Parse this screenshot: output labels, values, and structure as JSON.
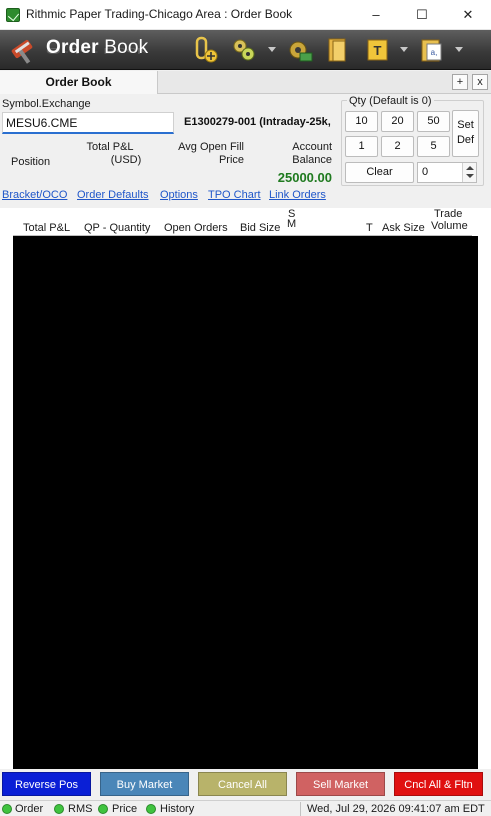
{
  "window": {
    "title": "Rithmic Paper Trading-Chicago Area : Order Book",
    "minimize_glyph": "–",
    "maximize_glyph": "☐",
    "close_glyph": "✕"
  },
  "toolbar": {
    "logo_bold": "Order",
    "logo_light": " Book",
    "icons": [
      "add-order-icon",
      "connect-icon",
      "settings-icon",
      "folder-icon",
      "text-icon",
      "clipboard-icon"
    ]
  },
  "panel": {
    "tab_label": "Order Book",
    "add_glyph": "+",
    "close_glyph": "x"
  },
  "info": {
    "symbol_label": "Symbol.Exchange",
    "symbol_value": "MESU6.CME",
    "account": "E1300279-001 (Intraday-25k,",
    "position_label": "Position",
    "total_pnl_label": "Total P&L",
    "total_pnl_unit": "(USD)",
    "avg_fill_label1": "Avg Open Fill",
    "avg_fill_label2": "Price",
    "account_balance_label1": "Account",
    "account_balance_label2": "Balance",
    "account_balance": "25000.00"
  },
  "qty": {
    "title": "Qty (Default is 0)",
    "buttons": [
      "10",
      "20",
      "50",
      "1",
      "2",
      "5"
    ],
    "set_def_line1": "Set",
    "set_def_line2": "Def",
    "clear_label": "Clear",
    "value": "0"
  },
  "links": [
    "Bracket/OCO",
    "Order Defaults",
    "Options",
    "TPO Chart",
    "Link Orders"
  ],
  "columns": {
    "total_pnl": "Total P&L",
    "qp_quantity": "QP - Quantity",
    "open_orders": "Open Orders",
    "bid_size": "Bid Size",
    "s": "S",
    "m": "M",
    "t": "T",
    "ask_size": "Ask Size",
    "trade": "Trade",
    "volume": "Volume"
  },
  "actions": {
    "reverse_pos": "Reverse Pos",
    "buy_market": "Buy Market",
    "cancel_all": "Cancel All",
    "sell_market": "Sell Market",
    "cncl_all_fltn": "Cncl All & Fltn",
    "colors": {
      "reverse_pos": "#0a1fd6",
      "buy_market": "#4a86b8",
      "cancel_all": "#b8b36a",
      "sell_market": "#d06262",
      "cncl_all_fltn": "#e01010"
    }
  },
  "status": {
    "order": "Order",
    "rms": "RMS",
    "price": "Price",
    "history": "History",
    "datetime": "Wed, Jul 29, 2026 09:41:07 am EDT",
    "indicator_color": "#3fc33f"
  }
}
